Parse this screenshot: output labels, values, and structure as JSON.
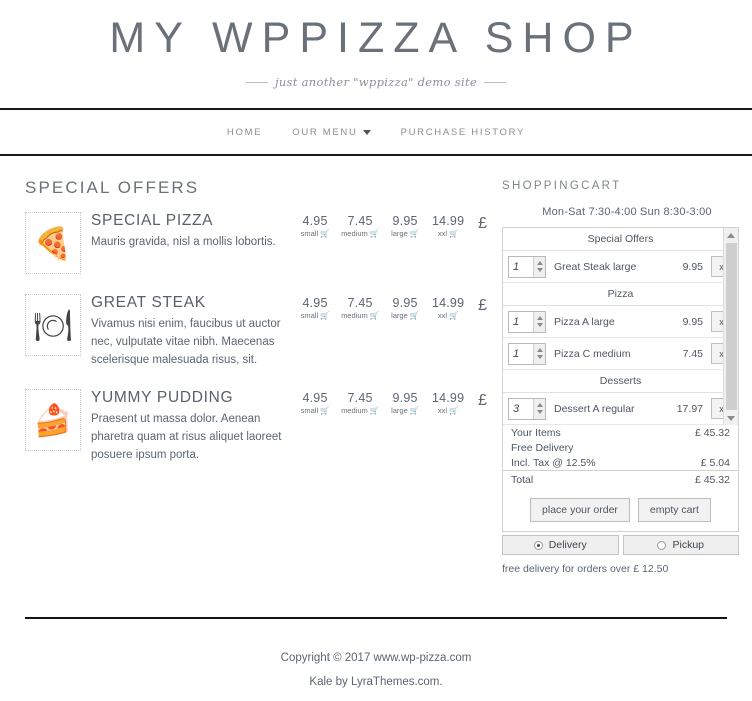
{
  "header": {
    "site_title": "MY WPPIZZA SHOP",
    "site_description": "just another \"wppizza\" demo site",
    "nav": [
      {
        "label": "HOME",
        "has_caret": false
      },
      {
        "label": "OUR MENU",
        "has_caret": true
      },
      {
        "label": "PURCHASE HISTORY",
        "has_caret": false
      }
    ]
  },
  "main": {
    "section_title": "SPECIAL OFFERS",
    "currency_symbol": "£",
    "cart_icon": "🛒",
    "items": [
      {
        "name": "SPECIAL PIZZA",
        "description": "Mauris gravida, nisl a mollis lobortis.",
        "image_icon": "🍕",
        "image_name": "pizza-image",
        "prices": [
          {
            "amount": "4.95",
            "size": "small"
          },
          {
            "amount": "7.45",
            "size": "medium"
          },
          {
            "amount": "9.95",
            "size": "large"
          },
          {
            "amount": "14.99",
            "size": "xxl"
          }
        ]
      },
      {
        "name": "GREAT STEAK",
        "description": "Vivamus nisi enim, faucibus ut auctor nec, vulputate vitae nibh. Maecenas scelerisque malesuada risus, sit.",
        "image_icon": "🍽",
        "image_name": "steak-image",
        "prices": [
          {
            "amount": "4.95",
            "size": "small"
          },
          {
            "amount": "7.45",
            "size": "medium"
          },
          {
            "amount": "9.95",
            "size": "large"
          },
          {
            "amount": "14.99",
            "size": "xxl"
          }
        ]
      },
      {
        "name": "YUMMY PUDDING",
        "description": "Praesent ut massa dolor. Aenean pharetra quam at risus aliquet laoreet posuere ipsum porta.",
        "image_icon": "🍰",
        "image_name": "pudding-image",
        "prices": [
          {
            "amount": "4.95",
            "size": "small"
          },
          {
            "amount": "7.45",
            "size": "medium"
          },
          {
            "amount": "9.95",
            "size": "large"
          },
          {
            "amount": "14.99",
            "size": "xxl"
          }
        ]
      }
    ]
  },
  "sidebar": {
    "title": "SHOPPINGCART",
    "opening_hours": "Mon-Sat  7:30-4:00  Sun  8:30-3:00",
    "groups": [
      {
        "label": "Special Offers",
        "rows": [
          {
            "qty": "1",
            "name": "Great Steak large",
            "price": "9.95",
            "remove": "x"
          }
        ]
      },
      {
        "label": "Pizza",
        "rows": [
          {
            "qty": "1",
            "name": "Pizza A large",
            "price": "9.95",
            "remove": "x"
          },
          {
            "qty": "1",
            "name": "Pizza C medium",
            "price": "7.45",
            "remove": "x"
          }
        ]
      },
      {
        "label": "Desserts",
        "rows": [
          {
            "qty": "3",
            "name": "Dessert A regular",
            "price": "17.97",
            "remove": "x"
          }
        ]
      }
    ],
    "totals": [
      {
        "label": "Your Items",
        "value": "£ 45.32",
        "final": false
      },
      {
        "label": "Free Delivery",
        "value": "",
        "final": false
      },
      {
        "label": "Incl. Tax @ 12.5%",
        "value": "£ 5.04",
        "final": false
      },
      {
        "label": "Total",
        "value": "£ 45.32",
        "final": true
      }
    ],
    "actions": [
      {
        "label": "place your order",
        "name": "place-order-button"
      },
      {
        "label": "empty cart",
        "name": "empty-cart-button"
      }
    ],
    "modes": [
      {
        "label": "Delivery",
        "selected": true
      },
      {
        "label": "Pickup",
        "selected": false
      }
    ],
    "free_delivery_note": "free delivery for orders over £ 12.50"
  },
  "footer": {
    "copyright": "Copyright © 2017 www.wp-pizza.com",
    "credit": "Kale by LyraThemes.com."
  }
}
